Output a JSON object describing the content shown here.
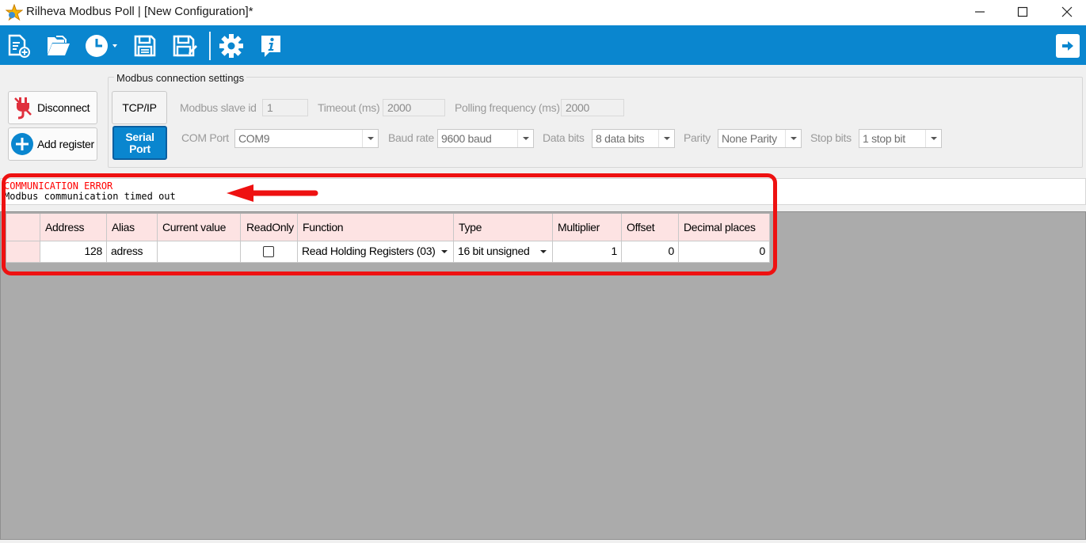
{
  "window": {
    "title": "Rilheva Modbus Poll | [New Configuration]*",
    "controls": {
      "minimize": "—",
      "maximize": "☐",
      "close": "✕"
    }
  },
  "toolbar": {
    "icons": [
      "new-file-icon",
      "open-folder-icon",
      "clock-icon",
      "save-icon",
      "save-as-icon",
      "gear-icon",
      "info-icon",
      "exit-icon"
    ],
    "accent": "#0a86cf"
  },
  "actions": {
    "disconnect_label": "Disconnect",
    "add_register_label": "Add register"
  },
  "connection": {
    "group_title": "Modbus connection settings",
    "tcpip_label": "TCP/IP",
    "serial_label": "Serial Port",
    "slave_id_label": "Modbus slave id",
    "slave_id_value": "1",
    "timeout_label": "Timeout (ms)",
    "timeout_value": "2000",
    "polling_label": "Polling frequency (ms)",
    "polling_value": "2000",
    "com_port_label": "COM Port",
    "com_port_value": "COM9",
    "baud_label": "Baud rate",
    "baud_value": "9600 baud",
    "data_bits_label": "Data bits",
    "data_bits_value": "8 data bits",
    "parity_label": "Parity",
    "parity_value": "None Parity",
    "stop_bits_label": "Stop bits",
    "stop_bits_value": "1 stop bit"
  },
  "status": {
    "error_title": "COMMUNICATION ERROR",
    "error_message": "Modbus communication timed out",
    "error_color": "#ff0000"
  },
  "registers": {
    "headers": {
      "address": "Address",
      "alias": "Alias",
      "current_value": "Current value",
      "readonly": "ReadOnly",
      "function": "Function",
      "type": "Type",
      "multiplier": "Multiplier",
      "offset": "Offset",
      "decimal_places": "Decimal places"
    },
    "rows": [
      {
        "address": "128",
        "alias": "adress",
        "current_value": "",
        "readonly": false,
        "function": "Read Holding Registers (03)",
        "type": "16 bit unsigned",
        "multiplier": "1",
        "offset": "0",
        "decimal_places": "0"
      }
    ]
  },
  "annotation": {
    "highlight_color": "#ee1111"
  }
}
